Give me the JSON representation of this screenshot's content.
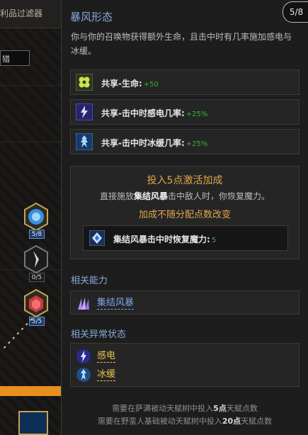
{
  "background": {
    "header_text": "利品过滤器",
    "input_value": "猎",
    "nodes": [
      {
        "name": "node-storm",
        "count": "5/8",
        "color": "#3a8fdc"
      },
      {
        "name": "node-fang",
        "count": "0/5",
        "color": "#bdbdbd"
      },
      {
        "name": "node-blood",
        "count": "5/5",
        "color": "#d03838"
      }
    ]
  },
  "tooltip": {
    "title": "暴风形态",
    "page_badge": "5/8",
    "description": "你与你的召唤物获得额外生命，且击中时有几率施加感电与冰缓。",
    "stats": [
      {
        "label": "共享-生命:",
        "value": "+50",
        "icon": "clover-icon"
      },
      {
        "label": "共享-击中时感电几率:",
        "value": "+25%",
        "icon": "lightning-icon"
      },
      {
        "label": "共享-击中时冰缓几率:",
        "value": "+25%",
        "icon": "chill-icon"
      }
    ],
    "bonus": {
      "title": "投入5点激活加成",
      "desc_prefix": "直接施放",
      "desc_skill": "集结风暴",
      "desc_suffix": "击中敌人时，你恢复魔力。",
      "note": "加成不随分配点数改变",
      "stat_label": "集结风暴击中时恢复魔力:",
      "stat_value": "5"
    },
    "related_abilities_title": "相关能力",
    "related_abilities": [
      {
        "label": "集结风暴",
        "icon": "storm-claw-icon"
      }
    ],
    "related_ailments_title": "相关异常状态",
    "related_ailments": [
      {
        "label": "感电",
        "icon": "shock-icon"
      },
      {
        "label": "冰缓",
        "icon": "chill-icon"
      }
    ],
    "footer": {
      "line1_prefix": "需要在萨满被动天赋树中投入",
      "line1_points": "5点",
      "line1_suffix": "天赋点数",
      "line2_prefix": "需要在野蛮人基础被动天赋树中投入",
      "line2_points": "20点",
      "line2_suffix": "天赋点数"
    }
  },
  "colors": {
    "title_blue": "#86a9d9",
    "bonus_gold": "#e3a64b",
    "stat_green": "#36b236",
    "link_blue": "#79a6ea",
    "link_gold": "#e7c24c"
  }
}
